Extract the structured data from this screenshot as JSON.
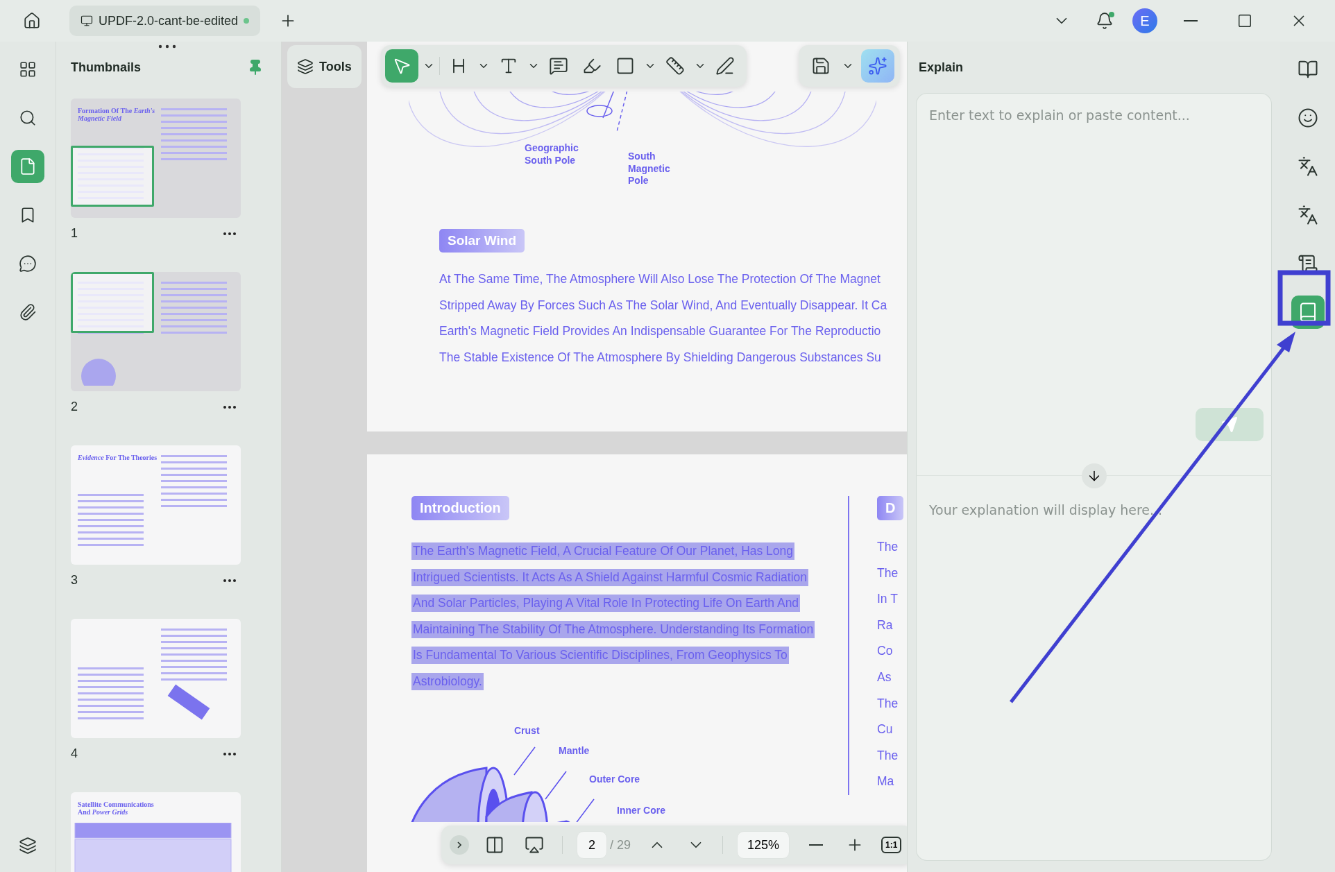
{
  "window": {
    "tab_title": "UPDF-2.0-cant-be-edited",
    "avatar_initial": "E"
  },
  "left_rail": [
    {
      "selected": false
    },
    {
      "selected": false
    },
    {
      "selected": true
    },
    {
      "selected": false
    },
    {
      "selected": false
    },
    {
      "selected": false
    },
    {
      "selected": false
    }
  ],
  "thumbnails": {
    "title": "Thumbnails",
    "pages": [
      {
        "number": "1",
        "title": "Formation Of The *Earth's Magnetic Field*",
        "in_view": true
      },
      {
        "number": "2",
        "in_view": true
      },
      {
        "number": "3",
        "title": "*Evidence* For The Theories",
        "in_view": false
      },
      {
        "number": "4",
        "in_view": false
      },
      {
        "title": "Satellite Communications And *Power Grids*",
        "in_view": false
      }
    ]
  },
  "toolbar": {
    "tools_label": "Tools",
    "tools": [
      {
        "selected": true,
        "dropdown": true
      },
      {
        "selected": false,
        "dropdown": true
      },
      {
        "selected": false,
        "dropdown": true
      },
      {
        "selected": false,
        "dropdown": false
      },
      {
        "selected": false,
        "dropdown": false
      },
      {
        "selected": false,
        "dropdown": true
      },
      {
        "selected": false,
        "dropdown": true
      },
      {
        "selected": false,
        "dropdown": false
      }
    ],
    "actions": [
      {
        "selected": false,
        "dropdown": true
      },
      {
        "selected": true,
        "dropdown": false
      }
    ]
  },
  "document": {
    "pages": [
      {
        "labels": [
          "Geographic South Pole",
          "South Magnetic Pole"
        ],
        "heading": "Solar Wind",
        "selected": false,
        "lines": [
          "At The Same Time, The Atmosphere Will Also Lose The Protection Of The Magnet",
          "Stripped Away By Forces Such As The Solar Wind, And Eventually Disappear. It Ca",
          "Earth's Magnetic Field Provides An Indispensable Guarantee For The Reproductio",
          "The Stable Existence Of The Atmosphere By Shielding Dangerous Substances Su"
        ]
      },
      {
        "heading": "Introduction",
        "selected": true,
        "lines": [
          "The Earth's Magnetic Field, A Crucial Feature Of Our Planet, Has Long",
          "Intrigued Scientists. It Acts As A Shield Against Harmful Cosmic Radiation",
          "And Solar Particles, Playing A Vital Role In Protecting Life On Earth And",
          "Maintaining The Stability Of The Atmosphere. Understanding Its Formation",
          "Is Fundamental To Various Scientific Disciplines, From Geophysics To",
          "Astrobiology."
        ],
        "figure_labels": [
          "Crust",
          "Mantle",
          "Outer Core",
          "Inner Core"
        ],
        "side_heading": "D",
        "side_lines": [
          "The",
          "The",
          "In T",
          "Ra",
          "Co",
          "As",
          "The",
          "Cu",
          "The",
          "Ma"
        ]
      }
    ]
  },
  "pager": {
    "page": "2",
    "total": "/ 29",
    "zoom": "125%",
    "actual_size": "1:1"
  },
  "explain": {
    "title": "Explain",
    "placeholder": "Enter text to explain or paste content...",
    "result_placeholder": "Your explanation will display here...",
    "send_disabled": true
  },
  "right_rail": [
    {
      "selected": false
    },
    {
      "selected": false
    },
    {
      "selected": false
    },
    {
      "selected": false
    },
    {
      "selected": false
    },
    {
      "selected": true
    }
  ]
}
